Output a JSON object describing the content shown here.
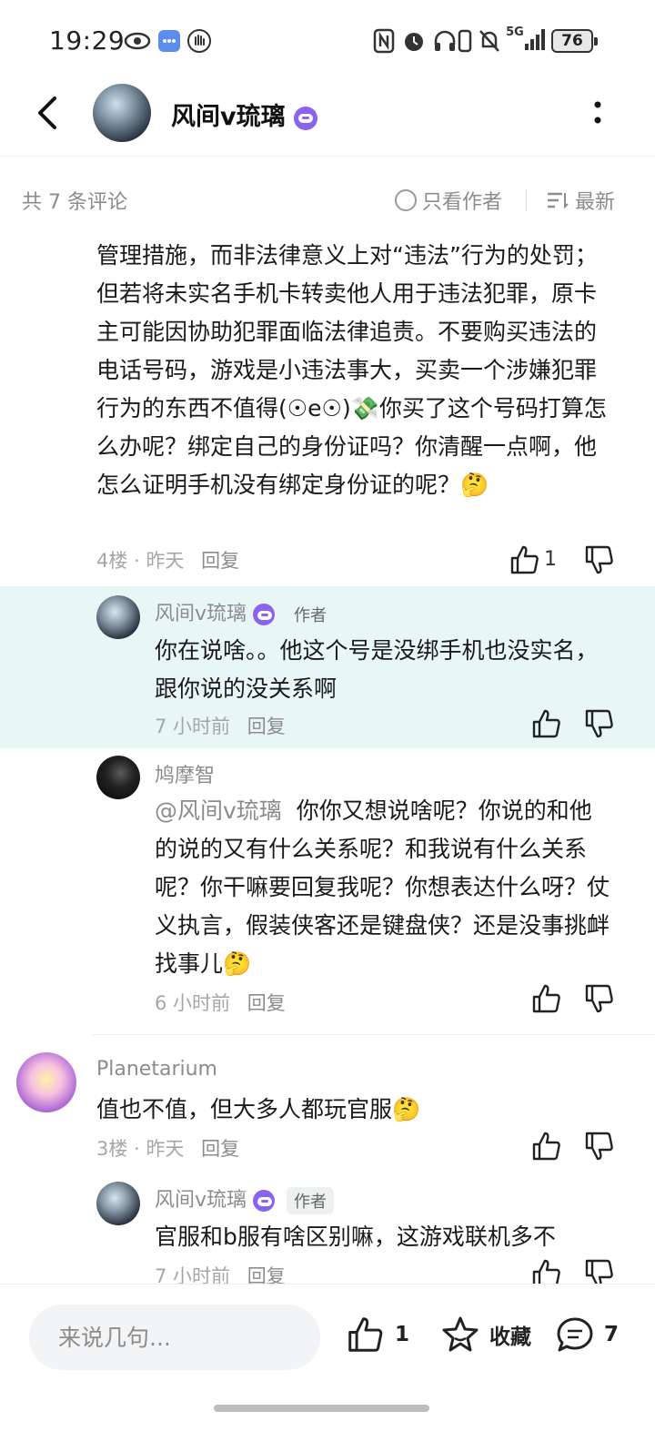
{
  "status_bar": {
    "time": "19:29",
    "network": "5G",
    "battery": "76",
    "icons": [
      "eye-icon",
      "chat-bubble-icon",
      "hand-icon",
      "nfc-icon",
      "alarm-icon",
      "headphones-icon",
      "vibrate-icon",
      "mute-icon",
      "signal-icon",
      "battery-icon"
    ]
  },
  "header": {
    "back_icon": "chevron-left-icon",
    "username": "风间v琉璃",
    "menu_icon": "more-vertical-icon"
  },
  "filter": {
    "count_text": "共 7 条评论",
    "only_author_label": "只看作者",
    "sort_label": "最新"
  },
  "comments": {
    "c4": {
      "body": "管理措施，而非法律意义上对“违法”行为的处罚；但若将未实名手机卡转卖他人用于违法犯罪，原卡主可能因协助犯罪面临法律追责。不要购买违法的电话号码，游戏是小违法事大，买卖一个涉嫌犯罪行为的东西不值得(☉e☉)💸你买了这个号码打算怎么办呢？绑定自己的身份证吗？你清醒一点啊，他怎么证明手机没有绑定身份证的呢？🤔",
      "floor": "4楼",
      "dot": "·",
      "time": "昨天",
      "reply": "回复",
      "likes": "1"
    },
    "r1": {
      "name": "风间v琉璃",
      "tag": "作者",
      "body": "你在说啥。。他这个号是没绑手机也没实名，跟你说的没关系啊",
      "time": "7 小时前",
      "reply": "回复"
    },
    "r2": {
      "name": "鸠摩智",
      "mention": "@风间v琉璃",
      "body": "你你又想说啥呢？你说的和他的说的又有什么关系呢？和我说有什么关系呢？你干嘛要回复我呢？你想表达什么呀？仗义执言，假装侠客还是键盘侠？还是没事挑衅找事儿🤔",
      "time": "6 小时前",
      "reply": "回复"
    },
    "c3": {
      "name": "Planetarium",
      "body": "值也不值，但大多人都玩官服🤔",
      "floor": "3楼",
      "dot": "·",
      "time": "昨天",
      "reply": "回复"
    },
    "r3": {
      "name": "风间v琉璃",
      "tag": "作者",
      "body": "官服和b服有啥区别嘛，这游戏联机多不",
      "time": "7 小时前",
      "reply": "回复"
    }
  },
  "bottom_bar": {
    "input_placeholder": "来说几句...",
    "like_count": "1",
    "favorite_label": "收藏",
    "comment_count": "7"
  }
}
